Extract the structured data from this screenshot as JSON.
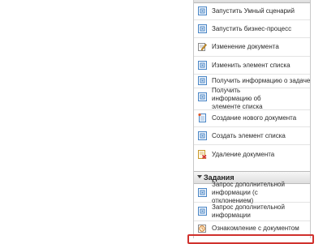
{
  "panel": {
    "items": [
      {
        "label": "Запустить Умный сценарий",
        "icon": "generic-action-icon"
      },
      {
        "label": "Запустить бизнес-процесс",
        "icon": "generic-action-icon"
      },
      {
        "label": "Изменение документа",
        "icon": "edit-document-icon"
      },
      {
        "label": "Изменить элемент списка",
        "icon": "generic-action-icon"
      },
      {
        "label": "Получить информацию о задаче",
        "icon": "generic-action-icon"
      },
      {
        "label": "Получить информацию об элементе списка",
        "icon": "generic-action-icon"
      },
      {
        "label": "Создание нового документа",
        "icon": "new-document-icon"
      },
      {
        "label": "Создать элемент списка",
        "icon": "generic-action-icon"
      },
      {
        "label": "Удаление документа",
        "icon": "delete-document-icon"
      }
    ]
  },
  "tasks_section": {
    "title": "Задания",
    "items": [
      {
        "label": "Запрос дополнительной информации (с отклонением)",
        "icon": "generic-action-icon"
      },
      {
        "label": "Запрос дополнительной информации",
        "icon": "generic-action-icon"
      },
      {
        "label": "Ознакомление с документом",
        "icon": "clock-task-icon"
      }
    ]
  },
  "colors": {
    "icon_blue": "#4a86c6",
    "highlight_red": "#d0312d",
    "header_gray": "#dedede"
  }
}
